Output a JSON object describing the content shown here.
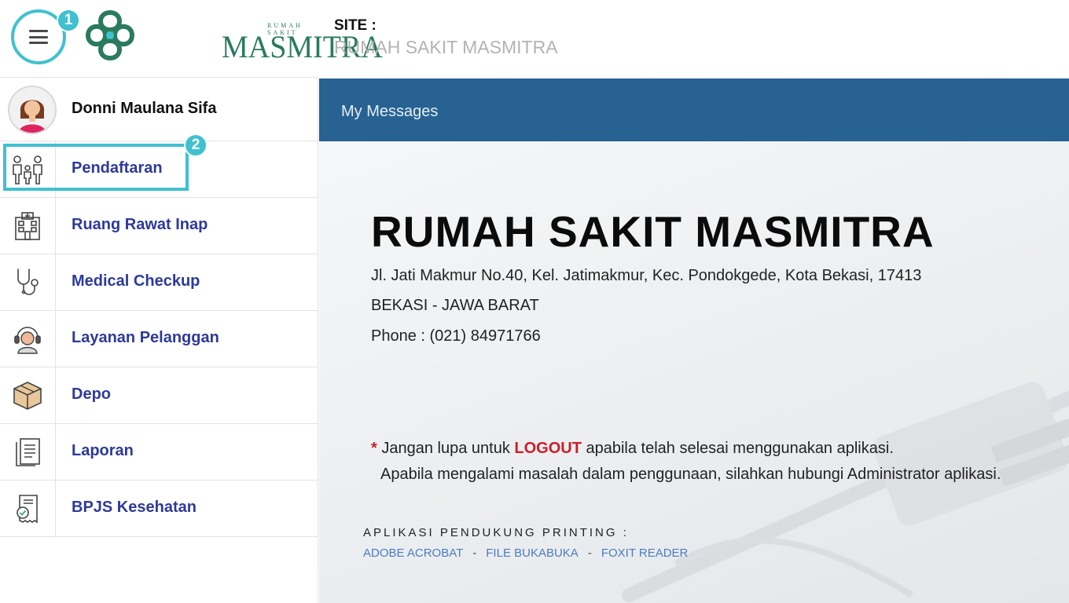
{
  "header": {
    "logo_small_text": "RUMAH SAKIT",
    "logo_text": "MASMITRA",
    "site_label": "SITE :",
    "site_name": "RUMAH SAKIT MASMITRA",
    "callout_menu": "1",
    "menu_icon": "hamburger-menu-icon"
  },
  "sidebar": {
    "user_name": "Donni Maulana Sifa",
    "callout_item": "2",
    "items": [
      {
        "label": "Pendaftaran",
        "icon": "family-icon"
      },
      {
        "label": "Ruang Rawat Inap",
        "icon": "hospital-building-icon"
      },
      {
        "label": "Medical Checkup",
        "icon": "stethoscope-icon"
      },
      {
        "label": "Layanan Pelanggan",
        "icon": "customer-service-icon"
      },
      {
        "label": "Depo",
        "icon": "box-icon"
      },
      {
        "label": "Laporan",
        "icon": "report-document-icon"
      },
      {
        "label": "BPJS Kesehatan",
        "icon": "bpjs-receipt-icon"
      }
    ]
  },
  "main": {
    "topbar_title": "My Messages",
    "hospital_name": "RUMAH SAKIT MASMITRA",
    "address_line_1": "Jl. Jati Makmur No.40, Kel. Jatimakmur, Kec. Pondokgede, Kota Bekasi, 17413",
    "address_line_2": "BEKASI - JAWA BARAT",
    "phone": "Phone : (021) 84971766",
    "note_star": "*",
    "note_before": " Jangan lupa untuk ",
    "note_logout": "LOGOUT",
    "note_after": " apabila telah selesai menggunakan aplikasi.",
    "note_line_2": "Apabila mengalami masalah dalam penggunaan, silahkan hubungi Administrator aplikasi.",
    "apps_label": "APLIKASI PENDUKUNG PRINTING :",
    "apps": [
      "ADOBE ACROBAT",
      "FILE BUKABUKA",
      "FOXIT READER"
    ],
    "apps_separator": "-"
  },
  "colors": {
    "accent": "#3fc1cf",
    "topbar": "#276292",
    "nav_text": "#2d3a9a",
    "logo_green": "#2b7a5e",
    "logout_red": "#c8202a",
    "link_blue": "#4a7dc0"
  }
}
